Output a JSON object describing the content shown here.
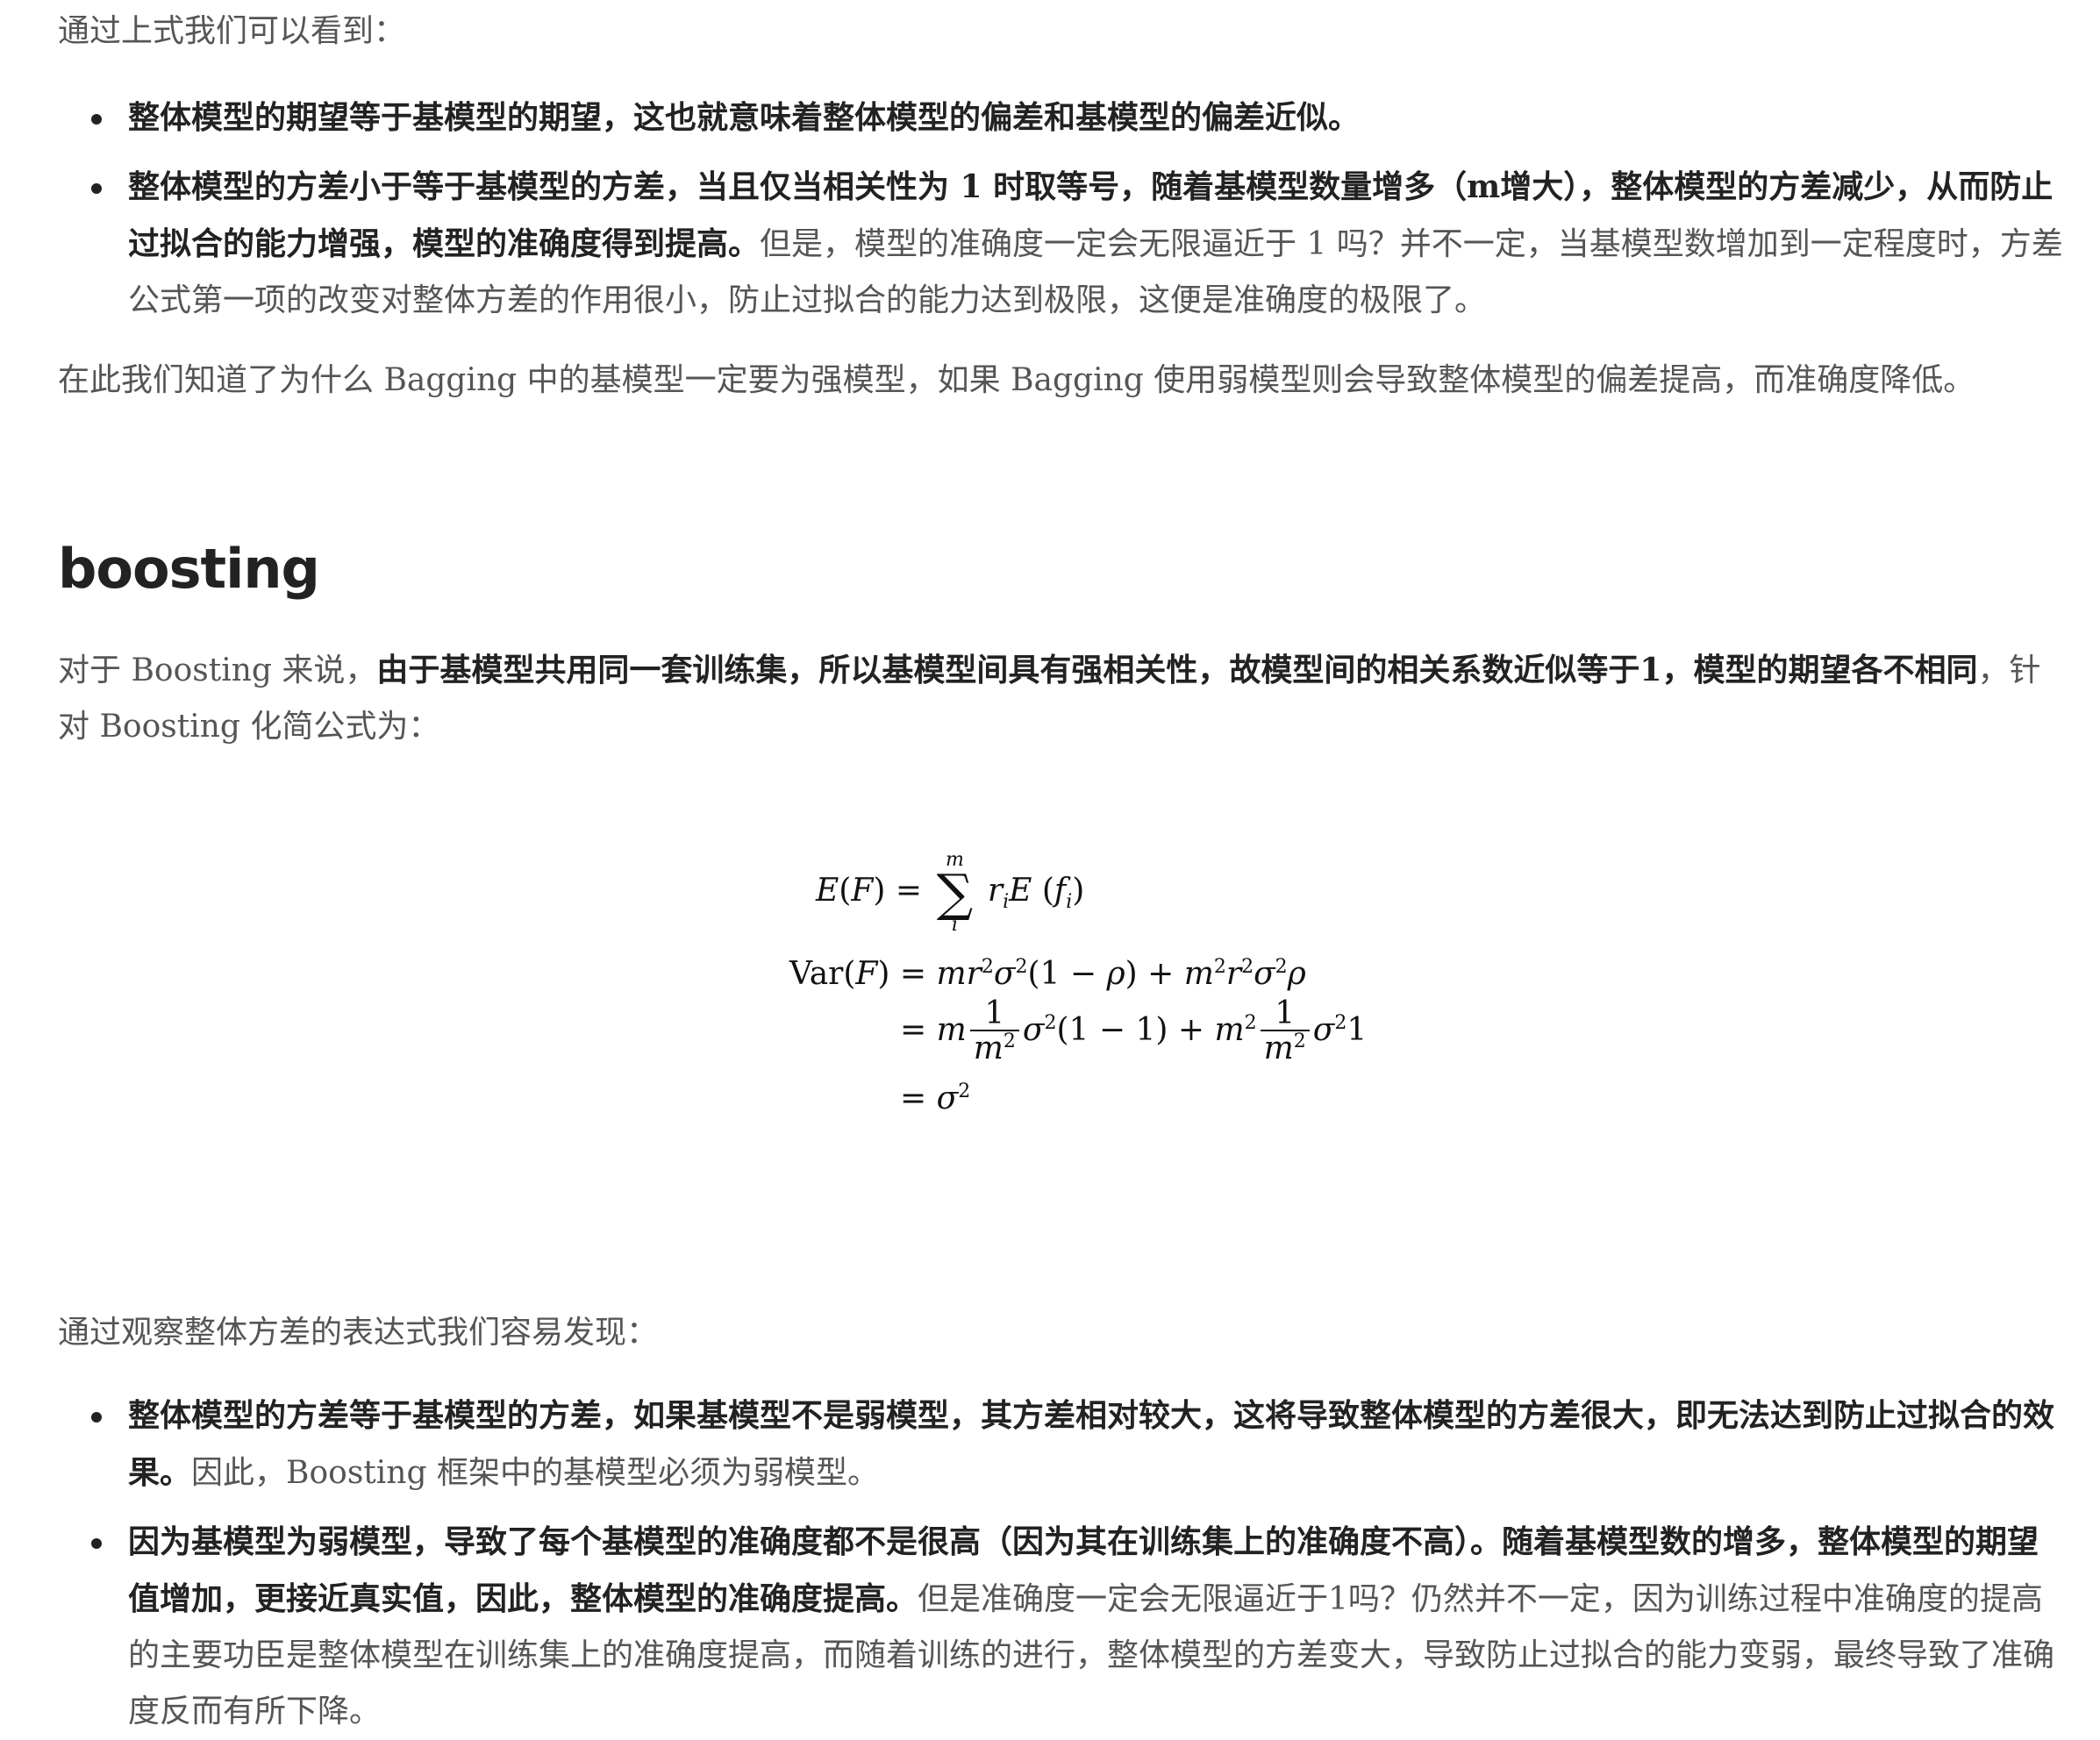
{
  "intro": "通过上式我们可以看到：",
  "bagging_points": [
    {
      "bold": "整体模型的期望等于基模型的期望，这也就意味着整体模型的偏差和基模型的偏差近似。",
      "plain": ""
    },
    {
      "bold": "整体模型的方差小于等于基模型的方差，当且仅当相关性为 1 时取等号，随着基模型数量增多（m增大），整体模型的方差减少，从而防止过拟合的能力增强，模型的准确度得到提高。",
      "plain": "但是，模型的准确度一定会无限逼近于 1 吗？并不一定，当基模型数增加到一定程度时，方差公式第一项的改变对整体方差的作用很小，防止过拟合的能力达到极限，这便是准确度的极限了。"
    }
  ],
  "bagging_conclusion": "在此我们知道了为什么 Bagging 中的基模型一定要为强模型，如果 Bagging 使用弱模型则会导致整体模型的偏差提高，而准确度降低。",
  "boosting_heading": "boosting",
  "boosting_intro": {
    "plain_start": "对于 Boosting 来说，",
    "bold": "由于基模型共用同一套训练集，所以基模型间具有强相关性，故模型间的相关系数近似等于1，模型的期望各不相同",
    "plain_end": "，针对 Boosting 化简公式为："
  },
  "formula": {
    "row1_lhs": "E(F)",
    "row1_rhs_tail": "r",
    "sum_top": "m",
    "sum_bot": "i",
    "row2_lhs": "Var(F)",
    "row3_num": "1",
    "row4": "= σ"
  },
  "observe_intro": "通过观察整体方差的表达式我们容易发现：",
  "boosting_points": [
    {
      "bold": "整体模型的方差等于基模型的方差，如果基模型不是弱模型，其方差相对较大，这将导致整体模型的方差很大，即无法达到防止过拟合的效果。",
      "plain": "因此，Boosting 框架中的基模型必须为弱模型。"
    },
    {
      "bold": "因为基模型为弱模型，导致了每个基模型的准确度都不是很高（因为其在训练集上的准确度不高）。随着基模型数的增多，整体模型的期望值增加，更接近真实值，因此，整体模型的准确度提高。",
      "plain": "但是准确度一定会无限逼近于1吗？仍然并不一定，因为训练过程中准确度的提高的主要功臣是整体模型在训练集上的准确度提高，而随着训练的进行，整体模型的方差变大，导致防止过拟合的能力变弱，最终导致了准确度反而有所下降。"
    }
  ]
}
